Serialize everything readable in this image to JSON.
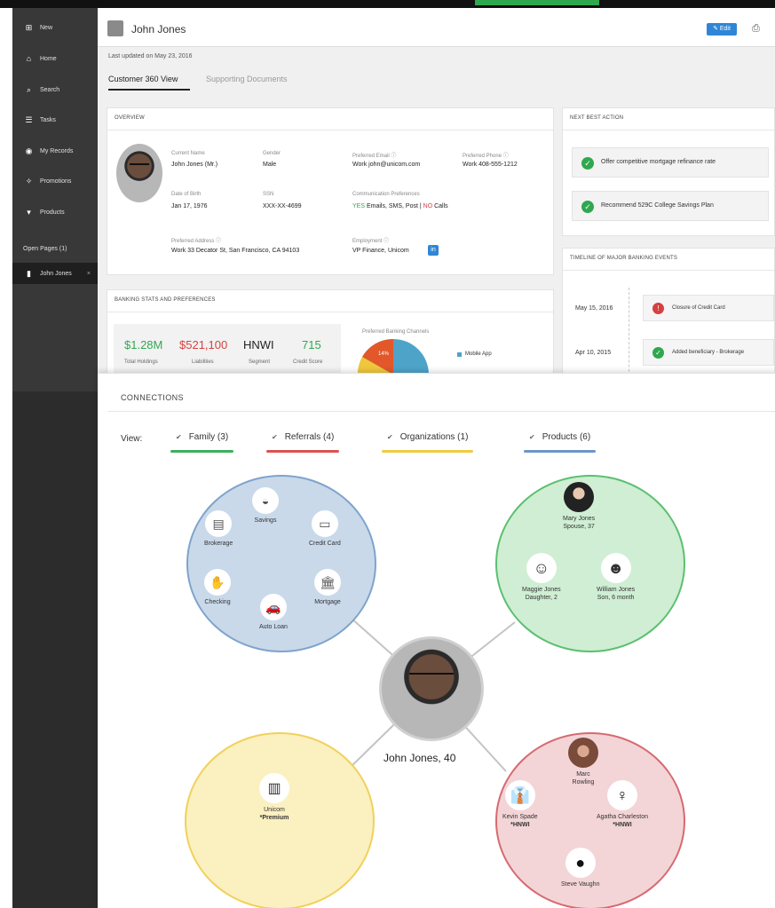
{
  "sidebar": {
    "items": [
      {
        "label": "New",
        "icon": "plus-icon"
      },
      {
        "label": "Home",
        "icon": "home-icon"
      },
      {
        "label": "Search",
        "icon": "search-icon"
      },
      {
        "label": "Tasks",
        "icon": "tasks-icon"
      },
      {
        "label": "My Records",
        "icon": "records-icon"
      },
      {
        "label": "Promotions",
        "icon": "promotions-icon"
      },
      {
        "label": "Products",
        "icon": "cart-icon"
      }
    ],
    "open_pages_label": "Open Pages (1)",
    "open_page": {
      "label": "John Jones",
      "close": "×"
    }
  },
  "header": {
    "name": "John Jones",
    "edit_label": "Edit",
    "last_updated": "Last updated on May 23, 2016"
  },
  "tabs": [
    "Customer 360 View",
    "Supporting Documents"
  ],
  "overview": {
    "title": "OVERVIEW",
    "current_name_label": "Current Name",
    "current_name": "John Jones (Mr.)",
    "gender_label": "Gender",
    "gender": "Male",
    "email_label": "Preferred Email ⓘ",
    "email": "Work  john@unicom.com",
    "phone_label": "Preferred Phone ⓘ",
    "phone": "Work  408-555-1212",
    "dob_label": "Date of Birth",
    "dob": "Jan 17, 1976",
    "ssn_label": "SSN",
    "ssn": "XXX-XX-4699",
    "comm_label": "Communication Preferences",
    "comm_yes": "YES",
    "comm_methods": "Emails, SMS, Post  |",
    "comm_no": "NO",
    "comm_calls": "Calls",
    "address_label": "Preferred Address ⓘ",
    "address": "Work  33 Decator St, San Francisco, CA 94103",
    "employment_label": "Employment ⓘ",
    "employment": "VP Finance, Unicom"
  },
  "next_best_action": {
    "title": "NEXT BEST ACTION",
    "items": [
      "Offer competitive mortgage refinance rate",
      "Recommend 529C College Savings Plan"
    ]
  },
  "timeline": {
    "title": "TIMELINE OF MAJOR BANKING EVENTS",
    "events": [
      {
        "date": "May 15, 2016",
        "text": "Closure of Credit Card",
        "status": "alert"
      },
      {
        "date": "Apr 10, 2015",
        "text": "Added beneficiary - Brokerage",
        "status": "ok"
      }
    ]
  },
  "banking": {
    "title": "BANKING STATS AND PREFERENCES",
    "stats": [
      {
        "value": "$1.28M",
        "label": "Total Holdings",
        "color": "#2fa84f"
      },
      {
        "value": "$521,100",
        "label": "Liabilities",
        "color": "#d64040"
      },
      {
        "value": "HNWI",
        "label": "Segment",
        "color": "#222222"
      },
      {
        "value": "715",
        "label": "Credit Score",
        "color": "#2fa84f"
      }
    ],
    "channels_label": "Preferred Banking Channels",
    "legend_item": "Mobile App",
    "pie_label": "14%"
  },
  "connections": {
    "title": "CONNECTIONS",
    "view_label": "View:",
    "filters": [
      {
        "label": "Family (3)",
        "color": "#3dae5c"
      },
      {
        "label": "Referrals (4)",
        "color": "#d9534f"
      },
      {
        "label": "Organizations (1)",
        "color": "#f0cb45"
      },
      {
        "label": "Products (6)",
        "color": "#6b96c6"
      }
    ],
    "center": {
      "name": "John Jones, 40"
    },
    "products": [
      {
        "label": "Savings",
        "icon": "piggy-bank-icon"
      },
      {
        "label": "Brokerage",
        "icon": "chart-board-icon"
      },
      {
        "label": "Credit Card",
        "icon": "credit-card-icon"
      },
      {
        "label": "Checking",
        "icon": "hand-money-icon"
      },
      {
        "label": "Mortgage",
        "icon": "bank-building-icon"
      },
      {
        "label": "Auto Loan",
        "icon": "car-icon"
      }
    ],
    "family": [
      {
        "name": "Mary Jones",
        "detail": "Spouse, 37"
      },
      {
        "name": "Maggie Jones",
        "detail": "Daughter, 2"
      },
      {
        "name": "William Jones",
        "detail": "Son, 6 month"
      }
    ],
    "organization": {
      "name": "Unicom",
      "tag": "*Premium"
    },
    "referrals": [
      {
        "name": "Marc",
        "detail": "Rowling"
      },
      {
        "name": "Kevin Spade",
        "detail": "*HNWI"
      },
      {
        "name": "Agatha Charleston",
        "detail": "*HNWI"
      },
      {
        "name": "Steve Vaughn",
        "detail": ""
      }
    ]
  }
}
